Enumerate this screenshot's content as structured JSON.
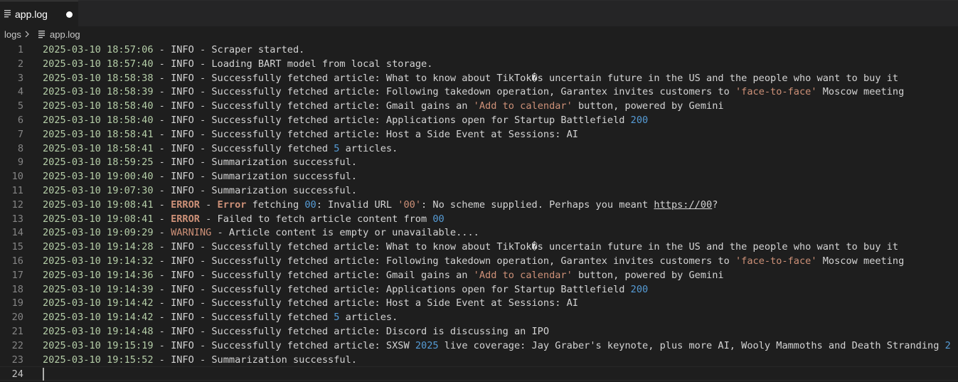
{
  "tab": {
    "label": "app.log",
    "dirty": true
  },
  "breadcrumb": {
    "folder": "logs",
    "file": "app.log"
  },
  "colors": {
    "background": "#1e1e1e",
    "timestamp": "#b5cea8",
    "number": "#569cd6",
    "string": "#ce9178",
    "text": "#d4d4d4"
  },
  "lines": [
    {
      "n": "1",
      "segs": [
        [
          "ts",
          "2025-03-10 18:57:06"
        ],
        [
          "dash",
          " - "
        ],
        [
          "info",
          "INFO"
        ],
        [
          "dash",
          " - "
        ],
        [
          "msg",
          "Scraper started."
        ]
      ]
    },
    {
      "n": "2",
      "segs": [
        [
          "ts",
          "2025-03-10 18:57:40"
        ],
        [
          "dash",
          " - "
        ],
        [
          "info",
          "INFO"
        ],
        [
          "dash",
          " - "
        ],
        [
          "msg",
          "Loading BART model from local storage."
        ]
      ]
    },
    {
      "n": "3",
      "segs": [
        [
          "ts",
          "2025-03-10 18:58:38"
        ],
        [
          "dash",
          " - "
        ],
        [
          "info",
          "INFO"
        ],
        [
          "dash",
          " - "
        ],
        [
          "msg",
          "Successfully fetched article: What to know about TikTok�s uncertain future in the US and the people who want to buy it"
        ]
      ]
    },
    {
      "n": "4",
      "segs": [
        [
          "ts",
          "2025-03-10 18:58:39"
        ],
        [
          "dash",
          " - "
        ],
        [
          "info",
          "INFO"
        ],
        [
          "dash",
          " - "
        ],
        [
          "msg",
          "Successfully fetched article: Following takedown operation, Garantex invites customers to "
        ],
        [
          "str",
          "'face-to-face'"
        ],
        [
          "msg",
          " Moscow meeting"
        ]
      ]
    },
    {
      "n": "5",
      "segs": [
        [
          "ts",
          "2025-03-10 18:58:40"
        ],
        [
          "dash",
          " - "
        ],
        [
          "info",
          "INFO"
        ],
        [
          "dash",
          " - "
        ],
        [
          "msg",
          "Successfully fetched article: Gmail gains an "
        ],
        [
          "str",
          "'Add to calendar'"
        ],
        [
          "msg",
          " button, powered by Gemini"
        ]
      ]
    },
    {
      "n": "6",
      "segs": [
        [
          "ts",
          "2025-03-10 18:58:40"
        ],
        [
          "dash",
          " - "
        ],
        [
          "info",
          "INFO"
        ],
        [
          "dash",
          " - "
        ],
        [
          "msg",
          "Successfully fetched article: Applications open for Startup Battlefield "
        ],
        [
          "num",
          "200"
        ]
      ]
    },
    {
      "n": "7",
      "segs": [
        [
          "ts",
          "2025-03-10 18:58:41"
        ],
        [
          "dash",
          " - "
        ],
        [
          "info",
          "INFO"
        ],
        [
          "dash",
          " - "
        ],
        [
          "msg",
          "Successfully fetched article: Host a Side Event at Sessions: AI"
        ]
      ]
    },
    {
      "n": "8",
      "segs": [
        [
          "ts",
          "2025-03-10 18:58:41"
        ],
        [
          "dash",
          " - "
        ],
        [
          "info",
          "INFO"
        ],
        [
          "dash",
          " - "
        ],
        [
          "msg",
          "Successfully fetched "
        ],
        [
          "num",
          "5"
        ],
        [
          "msg",
          " articles."
        ]
      ]
    },
    {
      "n": "9",
      "segs": [
        [
          "ts",
          "2025-03-10 18:59:25"
        ],
        [
          "dash",
          " - "
        ],
        [
          "info",
          "INFO"
        ],
        [
          "dash",
          " - "
        ],
        [
          "msg",
          "Summarization successful."
        ]
      ]
    },
    {
      "n": "10",
      "segs": [
        [
          "ts",
          "2025-03-10 19:00:40"
        ],
        [
          "dash",
          " - "
        ],
        [
          "info",
          "INFO"
        ],
        [
          "dash",
          " - "
        ],
        [
          "msg",
          "Summarization successful."
        ]
      ]
    },
    {
      "n": "11",
      "segs": [
        [
          "ts",
          "2025-03-10 19:07:30"
        ],
        [
          "dash",
          " - "
        ],
        [
          "info",
          "INFO"
        ],
        [
          "dash",
          " - "
        ],
        [
          "msg",
          "Summarization successful."
        ]
      ]
    },
    {
      "n": "12",
      "segs": [
        [
          "ts",
          "2025-03-10 19:08:41"
        ],
        [
          "dash",
          " - "
        ],
        [
          "err",
          "ERROR"
        ],
        [
          "dash",
          " - "
        ],
        [
          "err",
          "Error"
        ],
        [
          "msg",
          " fetching "
        ],
        [
          "num",
          "00"
        ],
        [
          "msg",
          ": Invalid URL "
        ],
        [
          "str",
          "'00'"
        ],
        [
          "msg",
          ": No scheme supplied. Perhaps you meant "
        ],
        [
          "link",
          "https://00"
        ],
        [
          "msg",
          "?"
        ]
      ]
    },
    {
      "n": "13",
      "segs": [
        [
          "ts",
          "2025-03-10 19:08:41"
        ],
        [
          "dash",
          " - "
        ],
        [
          "err",
          "ERROR"
        ],
        [
          "dash",
          " - "
        ],
        [
          "msg",
          "Failed to fetch article content from "
        ],
        [
          "num",
          "00"
        ]
      ]
    },
    {
      "n": "14",
      "segs": [
        [
          "ts",
          "2025-03-10 19:09:29"
        ],
        [
          "dash",
          " - "
        ],
        [
          "warn",
          "WARNING"
        ],
        [
          "dash",
          " - "
        ],
        [
          "msg",
          "Article content is empty or unavailable...."
        ]
      ]
    },
    {
      "n": "15",
      "segs": [
        [
          "ts",
          "2025-03-10 19:14:28"
        ],
        [
          "dash",
          " - "
        ],
        [
          "info",
          "INFO"
        ],
        [
          "dash",
          " - "
        ],
        [
          "msg",
          "Successfully fetched article: What to know about TikTok�s uncertain future in the US and the people who want to buy it"
        ]
      ]
    },
    {
      "n": "16",
      "segs": [
        [
          "ts",
          "2025-03-10 19:14:32"
        ],
        [
          "dash",
          " - "
        ],
        [
          "info",
          "INFO"
        ],
        [
          "dash",
          " - "
        ],
        [
          "msg",
          "Successfully fetched article: Following takedown operation, Garantex invites customers to "
        ],
        [
          "str",
          "'face-to-face'"
        ],
        [
          "msg",
          " Moscow meeting"
        ]
      ]
    },
    {
      "n": "17",
      "segs": [
        [
          "ts",
          "2025-03-10 19:14:36"
        ],
        [
          "dash",
          " - "
        ],
        [
          "info",
          "INFO"
        ],
        [
          "dash",
          " - "
        ],
        [
          "msg",
          "Successfully fetched article: Gmail gains an "
        ],
        [
          "str",
          "'Add to calendar'"
        ],
        [
          "msg",
          " button, powered by Gemini"
        ]
      ]
    },
    {
      "n": "18",
      "segs": [
        [
          "ts",
          "2025-03-10 19:14:39"
        ],
        [
          "dash",
          " - "
        ],
        [
          "info",
          "INFO"
        ],
        [
          "dash",
          " - "
        ],
        [
          "msg",
          "Successfully fetched article: Applications open for Startup Battlefield "
        ],
        [
          "num",
          "200"
        ]
      ]
    },
    {
      "n": "19",
      "segs": [
        [
          "ts",
          "2025-03-10 19:14:42"
        ],
        [
          "dash",
          " - "
        ],
        [
          "info",
          "INFO"
        ],
        [
          "dash",
          " - "
        ],
        [
          "msg",
          "Successfully fetched article: Host a Side Event at Sessions: AI"
        ]
      ]
    },
    {
      "n": "20",
      "segs": [
        [
          "ts",
          "2025-03-10 19:14:42"
        ],
        [
          "dash",
          " - "
        ],
        [
          "info",
          "INFO"
        ],
        [
          "dash",
          " - "
        ],
        [
          "msg",
          "Successfully fetched "
        ],
        [
          "num",
          "5"
        ],
        [
          "msg",
          " articles."
        ]
      ]
    },
    {
      "n": "21",
      "segs": [
        [
          "ts",
          "2025-03-10 19:14:48"
        ],
        [
          "dash",
          " - "
        ],
        [
          "info",
          "INFO"
        ],
        [
          "dash",
          " - "
        ],
        [
          "msg",
          "Successfully fetched article: Discord is discussing an IPO"
        ]
      ]
    },
    {
      "n": "22",
      "segs": [
        [
          "ts",
          "2025-03-10 19:15:19"
        ],
        [
          "dash",
          " - "
        ],
        [
          "info",
          "INFO"
        ],
        [
          "dash",
          " - "
        ],
        [
          "msg",
          "Successfully fetched article: SXSW "
        ],
        [
          "num",
          "2025"
        ],
        [
          "msg",
          " live coverage: Jay Graber's keynote, plus more AI, Wooly Mammoths and Death Stranding "
        ],
        [
          "num",
          "2"
        ]
      ]
    },
    {
      "n": "23",
      "segs": [
        [
          "ts",
          "2025-03-10 19:15:52"
        ],
        [
          "dash",
          " - "
        ],
        [
          "info",
          "INFO"
        ],
        [
          "dash",
          " - "
        ],
        [
          "msg",
          "Summarization successful."
        ]
      ]
    },
    {
      "n": "24",
      "segs": []
    }
  ]
}
